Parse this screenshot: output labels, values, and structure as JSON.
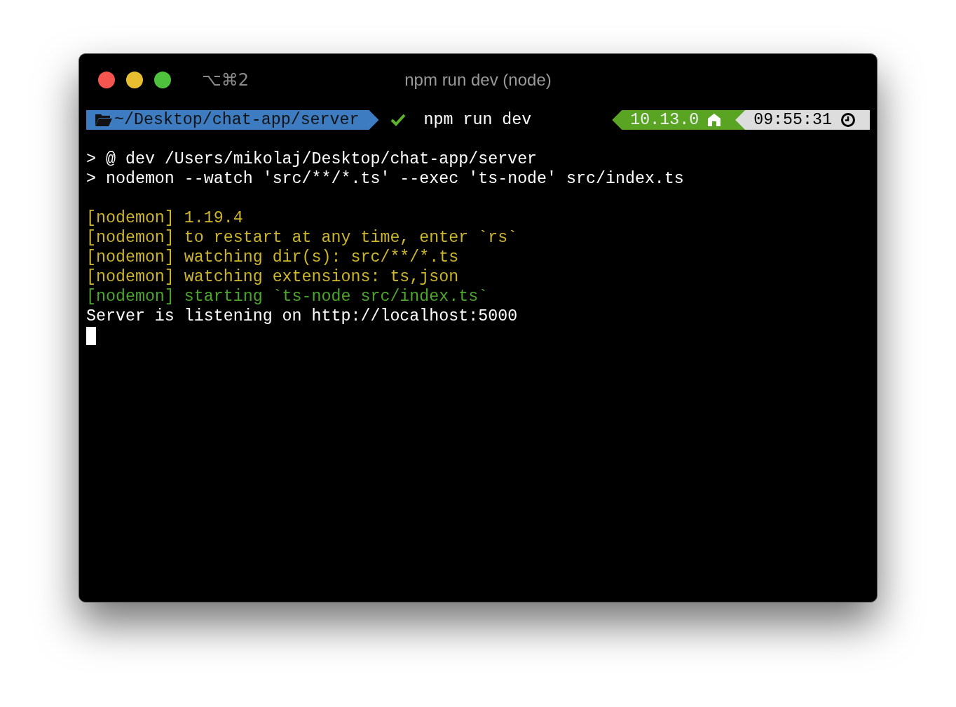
{
  "window": {
    "shortcut": "⌥⌘2",
    "title": "npm run dev (node)"
  },
  "prompt": {
    "path": "~/Desktop/chat-app/server",
    "status_ok": true,
    "command": "npm run dev",
    "node_version": "10.13.0",
    "time": "09:55:31"
  },
  "blocks": [
    {
      "lines": [
        {
          "text": "> @ dev /Users/mikolaj/Desktop/chat-app/server",
          "kind": "plain"
        },
        {
          "text": "> nodemon --watch 'src/**/*.ts' --exec 'ts-node' src/index.ts",
          "kind": "plain"
        }
      ]
    },
    {
      "lines": [
        {
          "text": "[nodemon] 1.19.4",
          "kind": "notice"
        },
        {
          "text": "[nodemon] to restart at any time, enter `rs`",
          "kind": "notice"
        },
        {
          "text": "[nodemon] watching dir(s): src/**/*.ts",
          "kind": "notice"
        },
        {
          "text": "[nodemon] watching extensions: ts,json",
          "kind": "notice"
        },
        {
          "text": "[nodemon] starting `ts-node src/index.ts`",
          "kind": "success"
        },
        {
          "text": "Server is listening on http://localhost:5000",
          "kind": "plain"
        }
      ]
    }
  ],
  "cursor_visible": true
}
